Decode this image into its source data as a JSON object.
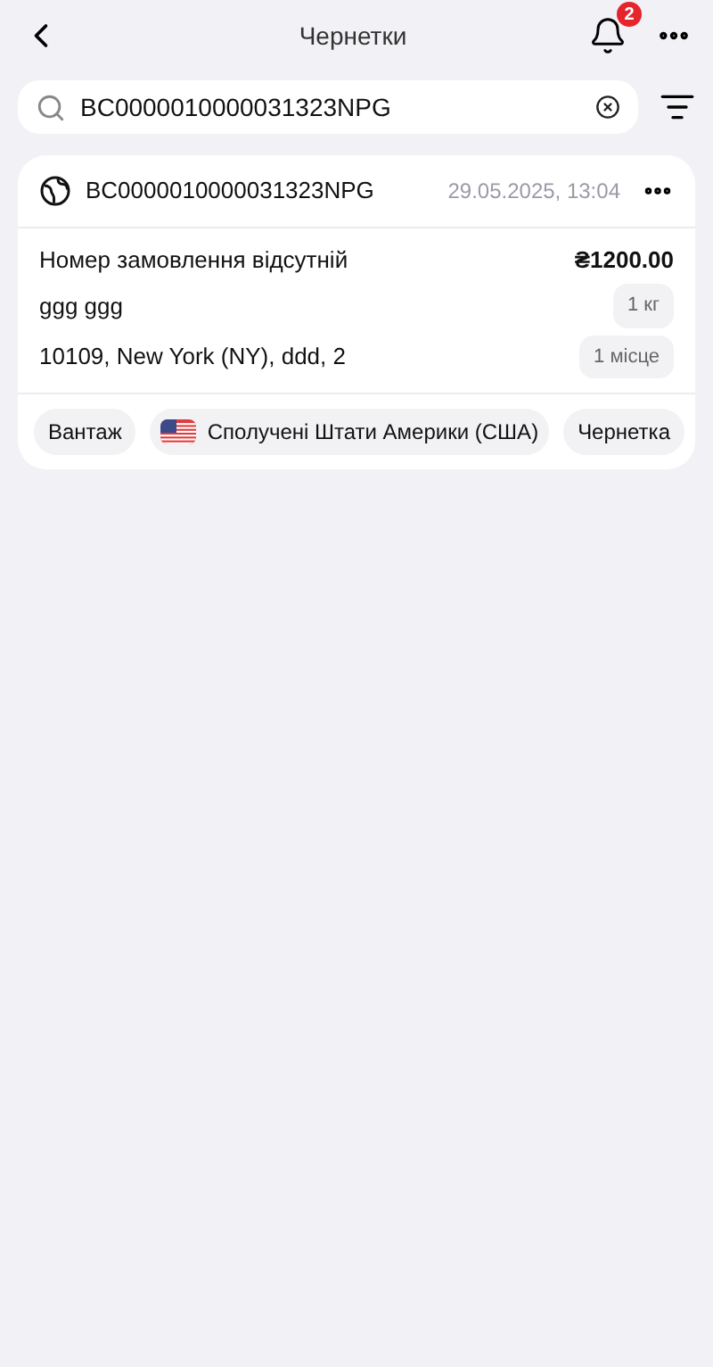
{
  "header": {
    "title": "Чернетки",
    "notification_count": "2"
  },
  "search": {
    "value": "BC0000010000031323NPG"
  },
  "cards": [
    {
      "tracking": "BC0000010000031323NPG",
      "date": "29.05.2025, 13:04",
      "order": "Номер замовлення відсутній",
      "price": "₴1200.00",
      "name": "ggg ggg",
      "weight": "1 кг",
      "address": "10109, New York (NY), ddd, 2",
      "places": "1 місце",
      "tags": [
        {
          "kind": "text",
          "label": "Вантаж"
        },
        {
          "kind": "flag",
          "label": "Сполучені Штати Америки (США)"
        }
      ],
      "status": "Чернетка"
    }
  ]
}
